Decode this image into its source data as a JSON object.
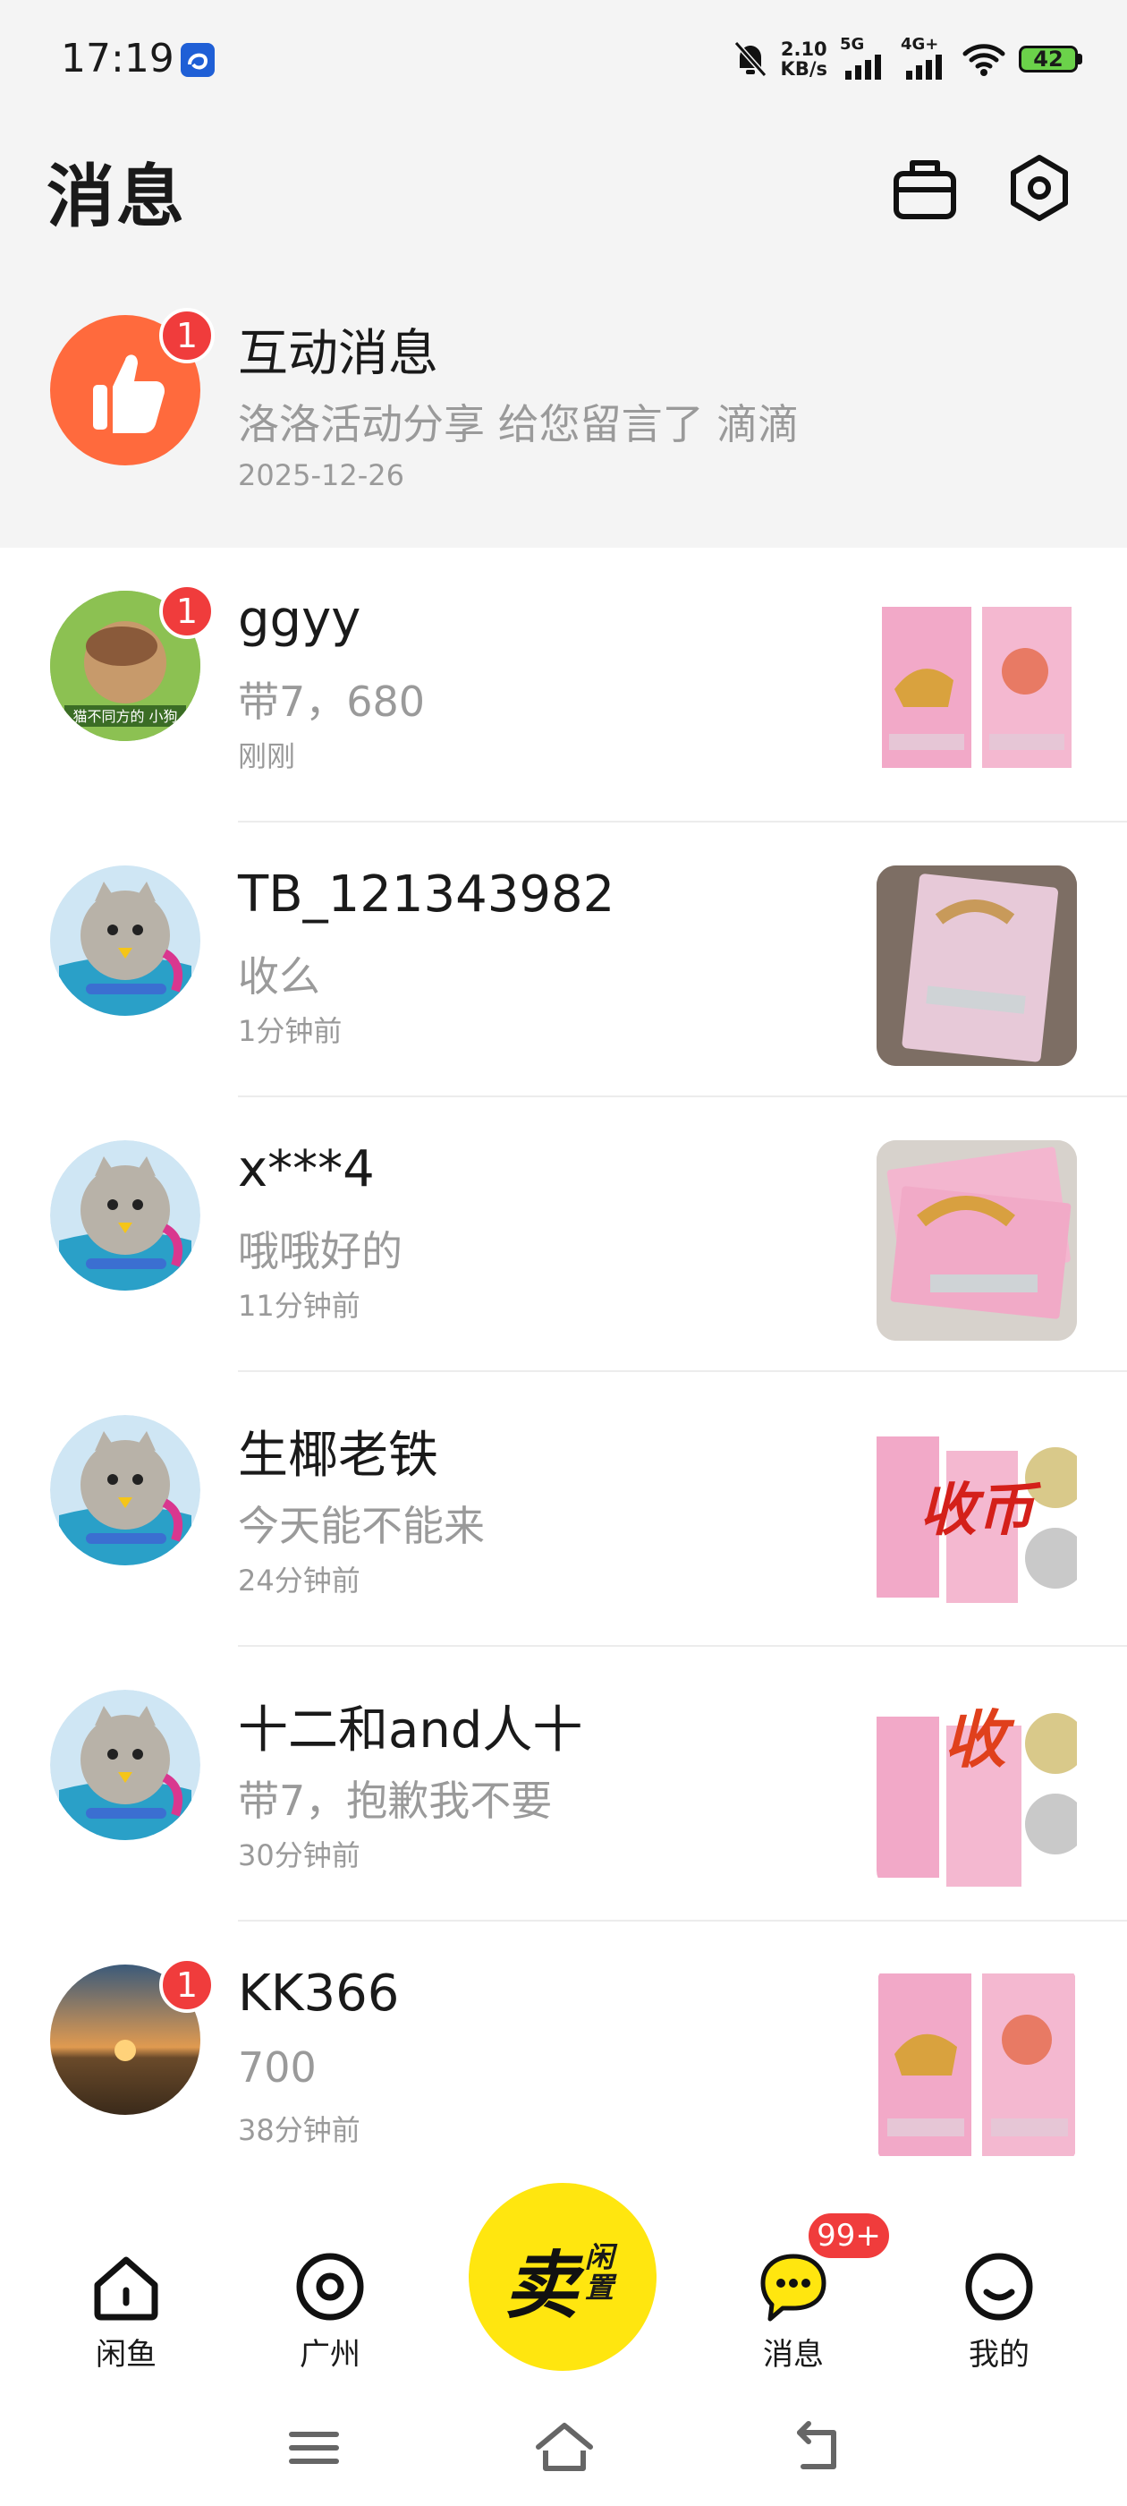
{
  "status_bar": {
    "time": "17:19",
    "net_speed_value": "2.10",
    "net_speed_unit": "KB/s",
    "signal1_label": "5G",
    "signal2_label": "4G+",
    "battery": "42",
    "battery_color": "#6bd24a"
  },
  "header": {
    "title": "消息",
    "icons": [
      "bag-icon",
      "settings-icon"
    ]
  },
  "interactive": {
    "title": "互动消息",
    "message": "洛洛活动分享 给您留言了 滴滴",
    "time": "2025-12-26",
    "badge": "1",
    "icon": "thumbs-up-icon",
    "icon_color": "#ff6a3d"
  },
  "conversations": [
    {
      "name": "ggyy",
      "message": "带7，680",
      "time": "刚刚",
      "badge": "1",
      "avatar": "cartoon-avatar"
    },
    {
      "name": "TB_121343982",
      "message": "收么",
      "time": "1分钟前",
      "badge": "",
      "avatar": "seal-avatar"
    },
    {
      "name": "x***4",
      "message": "哦哦好的",
      "time": "11分钟前",
      "badge": "",
      "avatar": "seal-avatar"
    },
    {
      "name": "生椰老铁",
      "message": "今天能不能来",
      "time": "24分钟前",
      "badge": "",
      "avatar": "seal-avatar"
    },
    {
      "name": "十二和and人十",
      "message": "带7，抱歉我不要",
      "time": "30分钟前",
      "badge": "",
      "avatar": "seal-avatar"
    },
    {
      "name": "KK366",
      "message": "700",
      "time": "38分钟前",
      "badge": "1",
      "avatar": "sunset-avatar"
    }
  ],
  "product_thumbs": {
    "stamp_text_1": "收币",
    "stamp_text_2": "收"
  },
  "bottom_nav": {
    "items": [
      {
        "label": "闲鱼",
        "icon": "home-icon"
      },
      {
        "label": "广州",
        "icon": "location-icon"
      },
      {
        "label": "消息",
        "icon": "chat-icon"
      },
      {
        "label": "我的",
        "icon": "profile-icon"
      }
    ],
    "sell_main": "卖",
    "sell_sub": "闲置",
    "message_badge": "99+",
    "sell_color": "#ffe60f"
  }
}
